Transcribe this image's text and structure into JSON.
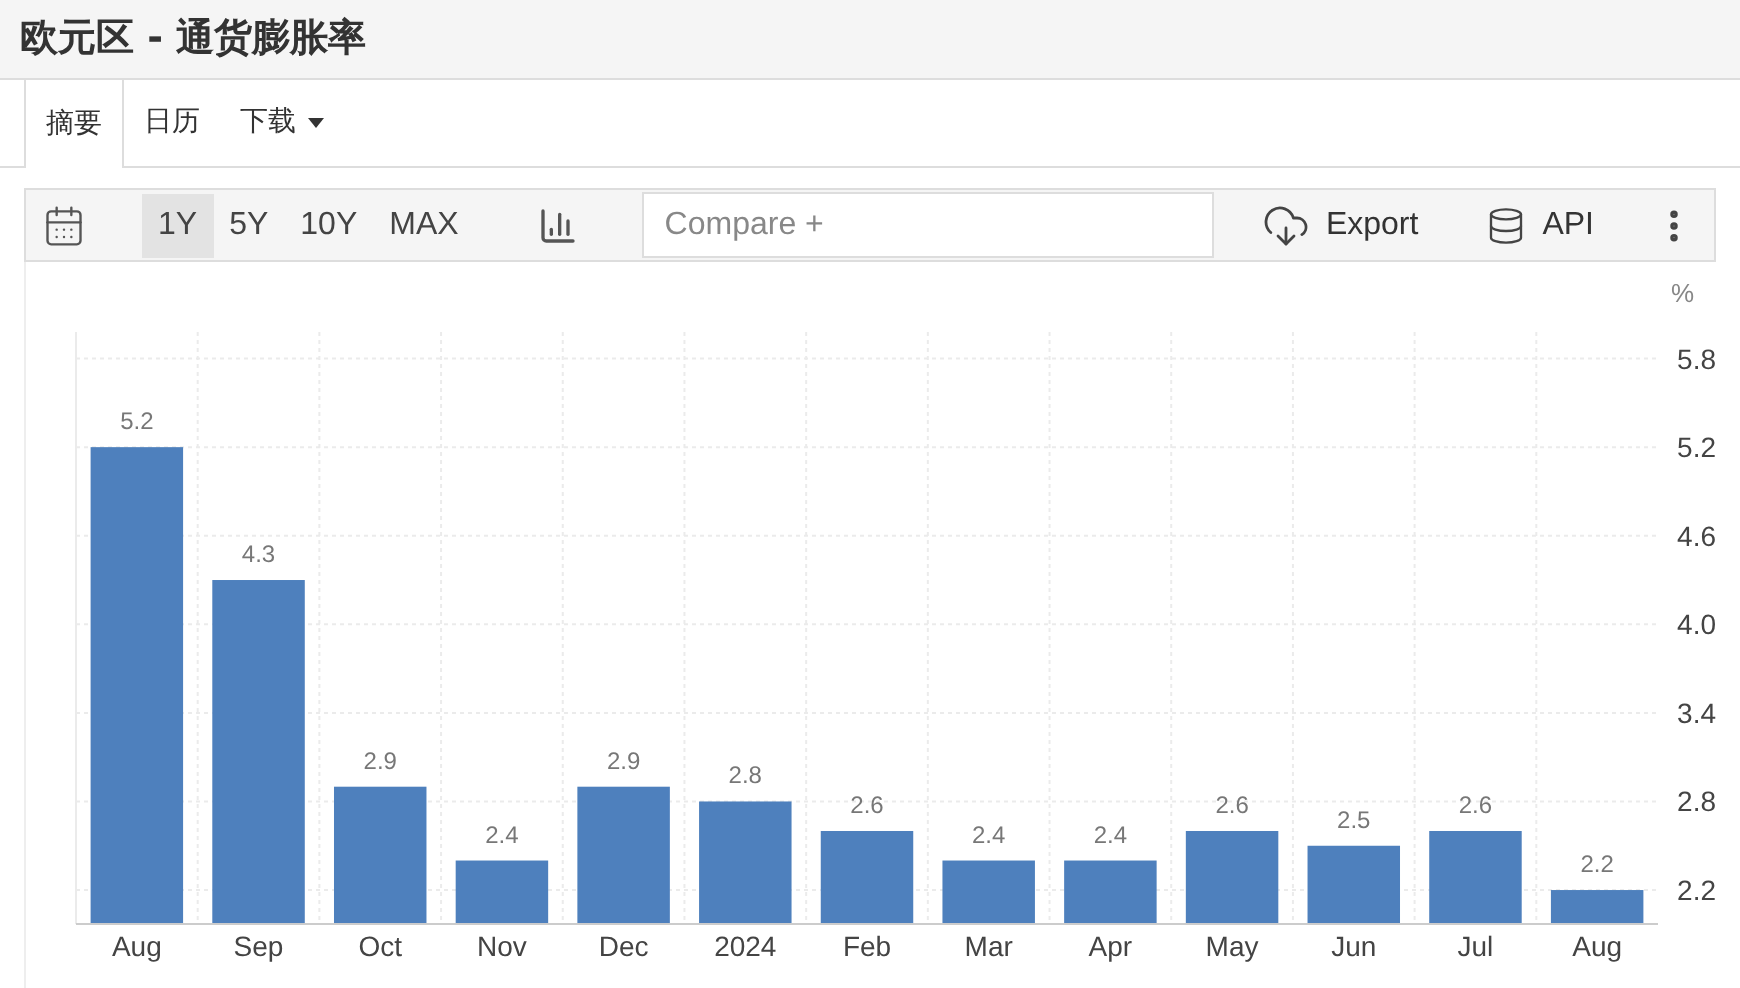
{
  "title": "欧元区 - 通货膨胀率",
  "tabs": [
    {
      "label": "摘要",
      "selected": true
    },
    {
      "label": "日历",
      "selected": false
    },
    {
      "label": "下载",
      "selected": false,
      "dropdown": true
    }
  ],
  "toolbar": {
    "ranges": [
      {
        "label": "1Y",
        "selected": true
      },
      {
        "label": "5Y",
        "selected": false
      },
      {
        "label": "10Y",
        "selected": false
      },
      {
        "label": "MAX",
        "selected": false
      }
    ],
    "compare": {
      "placeholder": "Compare +"
    },
    "export": "Export",
    "api": "API"
  },
  "chart": {
    "unit": "%",
    "chart_data": {
      "type": "bar",
      "categories": [
        "Aug",
        "Sep",
        "Oct",
        "Nov",
        "Dec",
        "2024",
        "Feb",
        "Mar",
        "Apr",
        "May",
        "Jun",
        "Jul",
        "Aug"
      ],
      "series": [
        {
          "color": "#4e80bd",
          "values": [
            5.2,
            4.3,
            2.9,
            2.4,
            2.9,
            2.8,
            2.6,
            2.4,
            2.4,
            2.6,
            2.5,
            2.6,
            2.2
          ]
        }
      ],
      "ylim": [
        1.97,
        5.98
      ],
      "yticks": [
        2.2,
        2.8,
        3.4,
        {
          "value": 4,
          "label": "4.0"
        },
        4.6,
        5.2,
        5.8
      ],
      "grid": true,
      "data_labels": true
    }
  }
}
